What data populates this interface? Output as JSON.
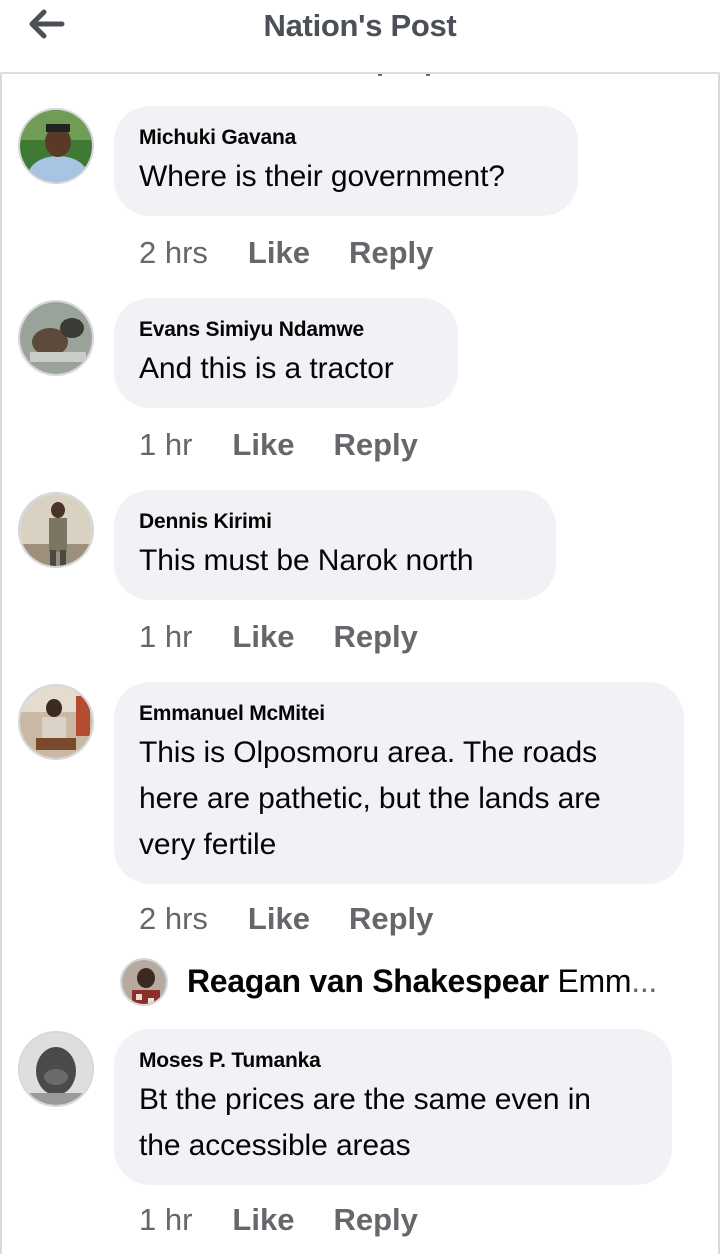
{
  "header": {
    "title": "Nation's Post",
    "back_icon": "arrow-left-icon"
  },
  "colors": {
    "bubble": "#f0f2f5",
    "meta_text": "#65676b",
    "title_text": "#4b4f56"
  },
  "comments": [
    {
      "author": "Michuki Gavana",
      "text": "Where is their government?",
      "time": "2 hrs",
      "like": "Like",
      "reply": "Reply"
    },
    {
      "author": "Evans Simiyu Ndamwe",
      "text": "And this is a tractor",
      "time": "1 hr",
      "like": "Like",
      "reply": "Reply"
    },
    {
      "author": "Dennis Kirimi",
      "text": "This must be Narok north",
      "time": "1 hr",
      "like": "Like",
      "reply": "Reply"
    },
    {
      "author": "Emmanuel McMitei",
      "text_lines": [
        "This is Olposmoru area. The roads",
        "here are pathetic, but the lands are",
        "very fertile"
      ],
      "time": "2 hrs",
      "like": "Like",
      "reply": "Reply"
    },
    {
      "author": "Moses P. Tumanka",
      "text_lines": [
        "Bt the prices are the same even in",
        "the accessible areas"
      ],
      "time": "1 hr",
      "like": "Like",
      "reply": "Reply"
    }
  ],
  "reply_preview": {
    "author": "Reagan van Shakespear",
    "snippet": "Emm",
    "ellipsis": "..."
  }
}
